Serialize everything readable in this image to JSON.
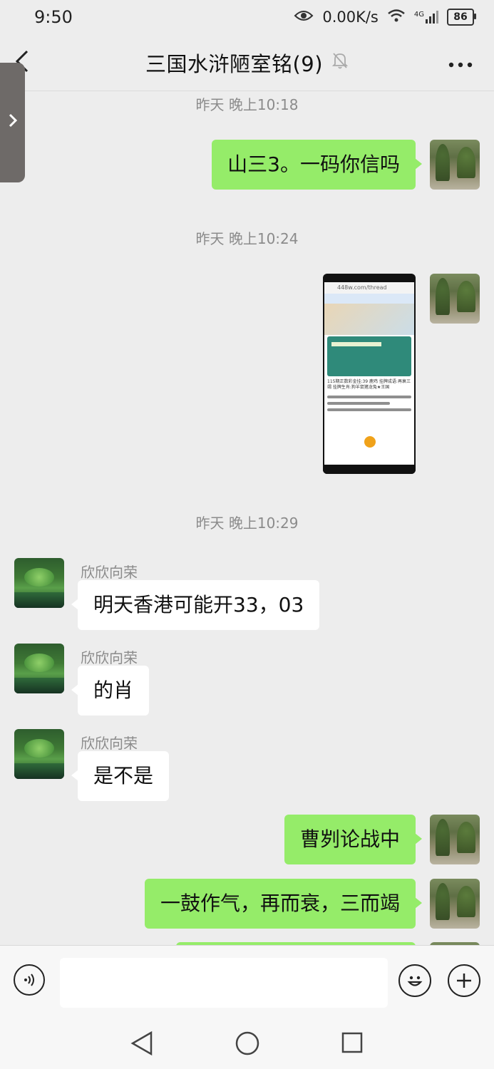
{
  "status_bar": {
    "time": "9:50",
    "network_speed": "0.00K/s",
    "signal": "4G",
    "battery": "86"
  },
  "header": {
    "title": "三国水浒陋室铭(9)"
  },
  "timestamps": [
    "昨天 晚上10:18",
    "昨天 晚上10:24",
    "昨天 晚上10:29"
  ],
  "messages": [
    {
      "side": "right",
      "type": "text",
      "text": "山三3。一码你信吗"
    },
    {
      "side": "right",
      "type": "image",
      "image_caption": "115期正数彩金挂:39 鹿鸡 挂牌成语:再衰三竭 挂牌生肖:狗羊鼠猪龙兔★王国"
    },
    {
      "side": "left",
      "sender": "欣欣向荣",
      "type": "text",
      "text": "明天香港可能开33，03"
    },
    {
      "side": "left",
      "sender": "欣欣向荣",
      "type": "text",
      "text": "的肖"
    },
    {
      "side": "left",
      "sender": "欣欣向荣",
      "type": "text",
      "text": "是不是"
    },
    {
      "side": "right",
      "type": "text",
      "text": "曹刿论战中"
    },
    {
      "side": "right",
      "type": "text",
      "text": "一鼓作气，再而衰，三而竭"
    }
  ],
  "input_bar": {
    "placeholder": ""
  },
  "icons": {
    "back": "chevron-left-icon",
    "mute": "bell-off-icon",
    "more": "more-dots-icon",
    "voice": "voice-icon",
    "emoji": "emoji-icon",
    "add": "plus-icon"
  },
  "colors": {
    "sent_bubble": "#95ec69",
    "received_bubble": "#ffffff",
    "background": "#ededed"
  }
}
